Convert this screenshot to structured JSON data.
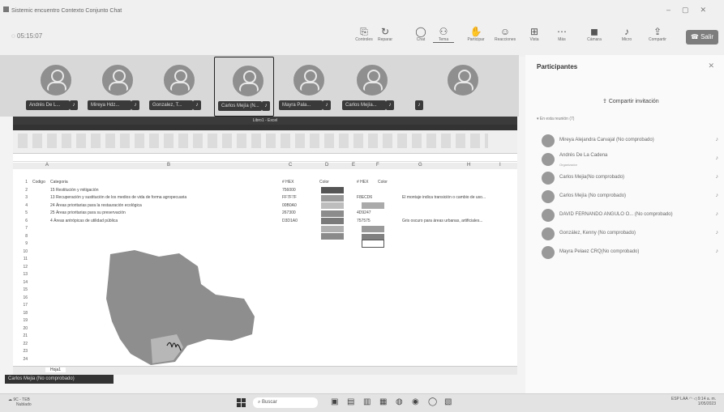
{
  "window": {
    "title": "Sistemic encuentro Contexto Conjunto Chat"
  },
  "meeting": {
    "timer": "05:15:07"
  },
  "toolbar": {
    "buttons": [
      {
        "label": "Controles",
        "icon": "screen-icon"
      },
      {
        "label": "Reparar",
        "icon": "refresh-icon"
      },
      {
        "label": "Chat",
        "icon": "chat-icon"
      },
      {
        "label": "Tema",
        "icon": "people-icon"
      },
      {
        "label": "Participar",
        "icon": "hand-icon"
      },
      {
        "label": "Reacciones",
        "icon": "smile-icon"
      },
      {
        "label": "Vista",
        "icon": "grid-icon"
      },
      {
        "label": "Más",
        "icon": "more-icon"
      },
      {
        "label": "Cámara",
        "icon": "camera-icon"
      },
      {
        "label": "Micro",
        "icon": "mic-icon"
      },
      {
        "label": "Compartir",
        "icon": "share-icon"
      }
    ],
    "leave_label": "Salir"
  },
  "gallery": [
    {
      "name": "Andrés De L...",
      "selected": false
    },
    {
      "name": "Mireya Hdz...",
      "selected": false
    },
    {
      "name": "Gonzalez, T...",
      "selected": false
    },
    {
      "name": "Carlos Mejía (N...",
      "selected": true
    },
    {
      "name": "Mayra Pala...",
      "selected": false
    },
    {
      "name": "Carlos Mejía...",
      "selected": false
    },
    {
      "name": "",
      "selected": false
    }
  ],
  "excel": {
    "title": "Libro1 - Excel",
    "columns": [
      "A",
      "B",
      "C",
      "D",
      "E",
      "F",
      "G",
      "H",
      "I"
    ],
    "rows": [
      {
        "n": "1",
        "a": "Codigo",
        "b": "Categoria",
        "c": "# HEX",
        "d": "Color",
        "e": "# HEX",
        "f": "Color",
        "g": ""
      },
      {
        "n": "2",
        "a": "",
        "b": "15 Restitución y mitigación",
        "c": "756000",
        "d": "",
        "e": "",
        "f": "",
        "g": ""
      },
      {
        "n": "3",
        "a": "",
        "b": "13 Recuperación y sustitución de los medios de vida de forma agropecuaria",
        "c": "FF7F7F",
        "d": "",
        "e": "F8ECD6",
        "f": "",
        "g": "El montaje indica transición o cambio de uso..."
      },
      {
        "n": "4",
        "a": "",
        "b": "24 Áreas prioritarias para la restauración ecológica",
        "c": "00B0A0",
        "d": "",
        "e": "",
        "f": "",
        "g": ""
      },
      {
        "n": "5",
        "a": "",
        "b": "25 Áreas prioritarias para su preservación",
        "c": "267300",
        "d": "",
        "e": "4D9247",
        "f": "",
        "g": ""
      },
      {
        "n": "6",
        "a": "",
        "b": "4 Áreas antrópicas de utilidad pública",
        "c": "D3D1A0",
        "d": "",
        "e": "757575",
        "f": "",
        "g": "Gris oscuro para áreas urbanas, artificiales..."
      }
    ],
    "row_numbers": [
      "1",
      "2",
      "3",
      "4",
      "5",
      "6",
      "7",
      "8",
      "9",
      "10",
      "11",
      "12",
      "13",
      "14",
      "15",
      "16",
      "17",
      "18",
      "19",
      "20",
      "21",
      "22",
      "23",
      "24"
    ],
    "sheet_tab": "Hoja1",
    "swatch_colors": [
      "#555555",
      "#9a9a9a",
      "#bdbdbd",
      "#8c8c8c",
      "#7a7a7a",
      "#b0b0b0",
      "#8a8a8a"
    ]
  },
  "participants": {
    "title": "Participantes",
    "invite_label": "Compartir invitación",
    "section": "En esta reunión (7)",
    "list": [
      {
        "name": "Mireya Alejandra Carvajal (No comprobado)",
        "role": ""
      },
      {
        "name": "Andrés De La Cadena",
        "role": "Organizador"
      },
      {
        "name": "Carlos Mejia(No comprobado)",
        "role": ""
      },
      {
        "name": "Carlos Mejía (No comprobado)",
        "role": ""
      },
      {
        "name": "DAVID FERNANDO ANGULO O... (No comprobado)",
        "role": ""
      },
      {
        "name": "González, Kenny (No comprobado)",
        "role": ""
      },
      {
        "name": "Mayra Pelaez CRQ(No comprobado)",
        "role": ""
      }
    ]
  },
  "presenter": {
    "label": "Carlos Mejia (No comprobado)"
  },
  "taskbar": {
    "weather_temp": "9C - TEB",
    "weather_desc": "Nublado",
    "search_label": "Buscar",
    "tray_lang": "ESP LAA",
    "tray_time": "9:14 a. m.",
    "tray_date": "1/05/2023"
  }
}
